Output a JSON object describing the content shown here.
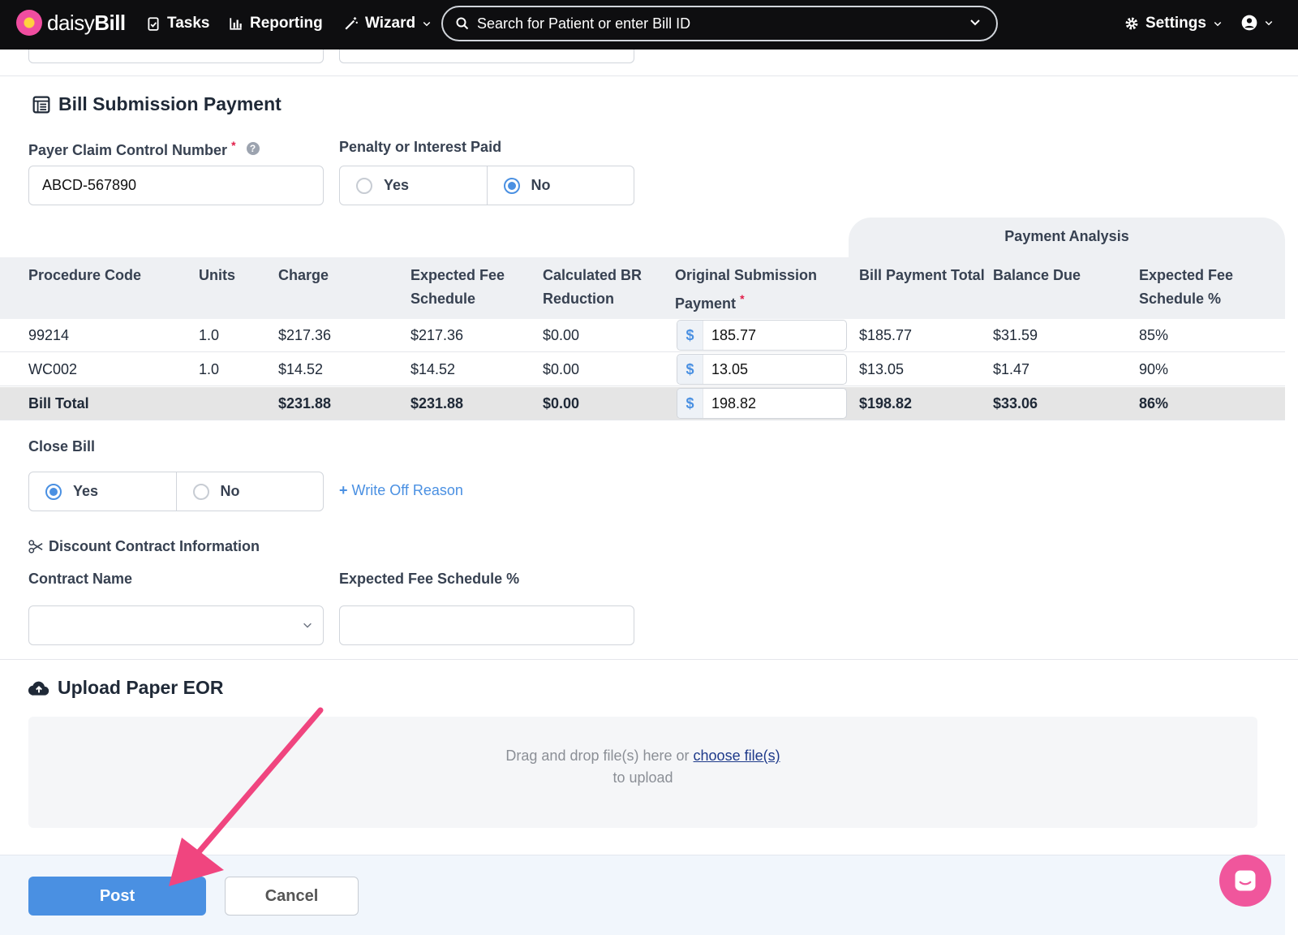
{
  "nav": {
    "brand_light": "daisy",
    "brand_bold": "Bill",
    "tasks": "Tasks",
    "reporting": "Reporting",
    "wizard": "Wizard",
    "search_placeholder": "Search for Patient or enter Bill ID",
    "settings": "Settings"
  },
  "payment": {
    "title": "Bill Submission Payment",
    "claim_label": "Payer Claim Control Number",
    "claim_value": "ABCD-567890",
    "help": "?",
    "penalty_label": "Penalty or Interest Paid",
    "penalty_options": [
      "Yes",
      "No"
    ],
    "penalty_selected": "No"
  },
  "table": {
    "analysis_header": "Payment Analysis",
    "columns": [
      "Procedure Code",
      "Units",
      "Charge",
      "Expected Fee Schedule",
      "Calculated BR Reduction",
      "Original Submission Payment",
      "Bill Payment Total",
      "Balance Due",
      "Expected Fee Schedule %"
    ],
    "currency": "$",
    "rows": [
      {
        "code": "99214",
        "units": "1.0",
        "charge": "$217.36",
        "fee": "$217.36",
        "br": "$0.00",
        "payment": "185.77",
        "total": "$185.77",
        "balance": "$31.59",
        "pct": "85%"
      },
      {
        "code": "WC002",
        "units": "1.0",
        "charge": "$14.52",
        "fee": "$14.52",
        "br": "$0.00",
        "payment": "13.05",
        "total": "$13.05",
        "balance": "$1.47",
        "pct": "90%"
      }
    ],
    "total": {
      "code": "Bill Total",
      "units": "",
      "charge": "$231.88",
      "fee": "$231.88",
      "br": "$0.00",
      "payment": "198.82",
      "total": "$198.82",
      "balance": "$33.06",
      "pct": "86%"
    }
  },
  "close_bill": {
    "label": "Close Bill",
    "options": [
      "Yes",
      "No"
    ],
    "selected": "Yes",
    "write_off": "Write Off Reason"
  },
  "discount": {
    "title": "Discount Contract Information",
    "contract_label": "Contract Name",
    "contract_value": "",
    "fee_pct_label": "Expected Fee Schedule %",
    "fee_pct_value": ""
  },
  "upload": {
    "title": "Upload Paper EOR",
    "drop_text": "Drag and drop file(s) here or",
    "choose": "choose file(s)",
    "drop_text2": "to upload"
  },
  "footer": {
    "post": "Post",
    "cancel": "Cancel"
  },
  "colors": {
    "accent": "#4a90e2",
    "nav_bg": "#0e0e10",
    "arrow": "#f0457f",
    "chat": "#f0569c"
  }
}
